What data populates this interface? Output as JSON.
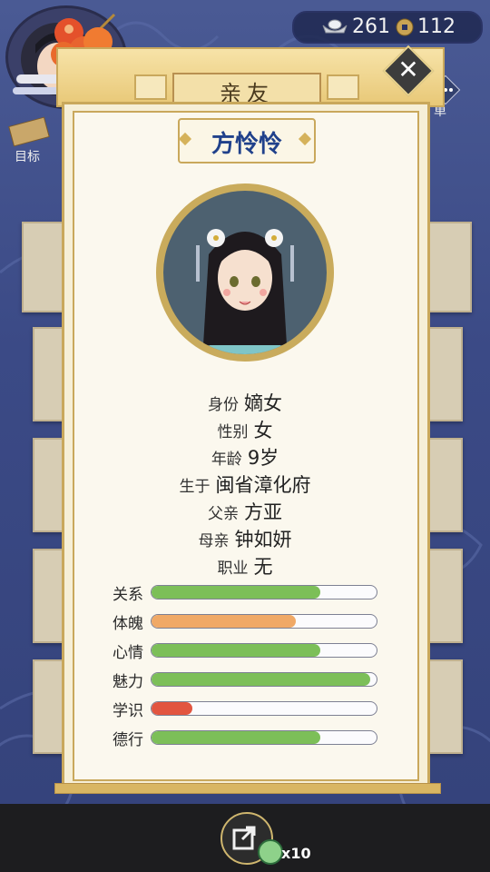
{
  "hud": {
    "silver": "261",
    "coins": "112",
    "goal_label": "目标",
    "menu_label_fragment": "单"
  },
  "modal": {
    "title": "亲友",
    "name": "方怜怜"
  },
  "info": [
    {
      "key": "身份",
      "value": "嫡女"
    },
    {
      "key": "性别",
      "value": "女"
    },
    {
      "key": "年龄",
      "value": "9岁"
    },
    {
      "key": "生于",
      "value": "闽省漳化府"
    },
    {
      "key": "父亲",
      "value": "方亚"
    },
    {
      "key": "母亲",
      "value": "钟如妍"
    },
    {
      "key": "职业",
      "value": "无"
    }
  ],
  "stats": [
    {
      "label": "关系",
      "fraction": 0.75,
      "color": "#7cbf58"
    },
    {
      "label": "体魄",
      "fraction": 0.64,
      "color": "#f0a966"
    },
    {
      "label": "心情",
      "fraction": 0.75,
      "color": "#7cbf58"
    },
    {
      "label": "魅力",
      "fraction": 0.97,
      "color": "#7cbf58"
    },
    {
      "label": "学识",
      "fraction": 0.18,
      "color": "#e2553f"
    },
    {
      "label": "德行",
      "fraction": 0.75,
      "color": "#7cbf58"
    }
  ],
  "bottom": {
    "count": "x10"
  },
  "icons": [
    "close-icon",
    "share-icon",
    "silver-ingot-icon",
    "copper-coin-icon",
    "goal-scroll-icon",
    "jade-coin-icon"
  ]
}
